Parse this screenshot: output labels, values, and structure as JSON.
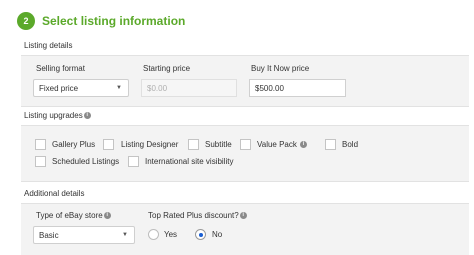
{
  "step": {
    "number": "2",
    "title": "Select listing information"
  },
  "listing_details": {
    "heading": "Listing details",
    "selling_format_label": "Selling format",
    "selling_format_value": "Fixed price",
    "starting_price_label": "Starting price",
    "starting_price_value": "$0.00",
    "bin_price_label": "Buy It Now price",
    "bin_price_value": "$500.00"
  },
  "listing_upgrades": {
    "heading": "Listing upgrades",
    "items": [
      {
        "label": "Gallery Plus",
        "checked": false
      },
      {
        "label": "Listing Designer",
        "checked": false
      },
      {
        "label": "Subtitle",
        "checked": false
      },
      {
        "label": "Value Pack",
        "checked": false
      },
      {
        "label": "Bold",
        "checked": false
      },
      {
        "label": "Scheduled Listings",
        "checked": false
      },
      {
        "label": "International site visibility",
        "checked": false
      }
    ]
  },
  "additional_details": {
    "heading": "Additional details",
    "store_type_label": "Type of eBay store",
    "store_type_value": "Basic",
    "top_rated_label": "Top Rated Plus discount?",
    "options": [
      {
        "label": "Yes",
        "selected": false
      },
      {
        "label": "No",
        "selected": true
      }
    ]
  },
  "icons": {
    "info": "info-icon",
    "dropdown": "chevron-down-icon",
    "accent_color": "#5ba92a",
    "radio_color": "#1a5fd3"
  }
}
